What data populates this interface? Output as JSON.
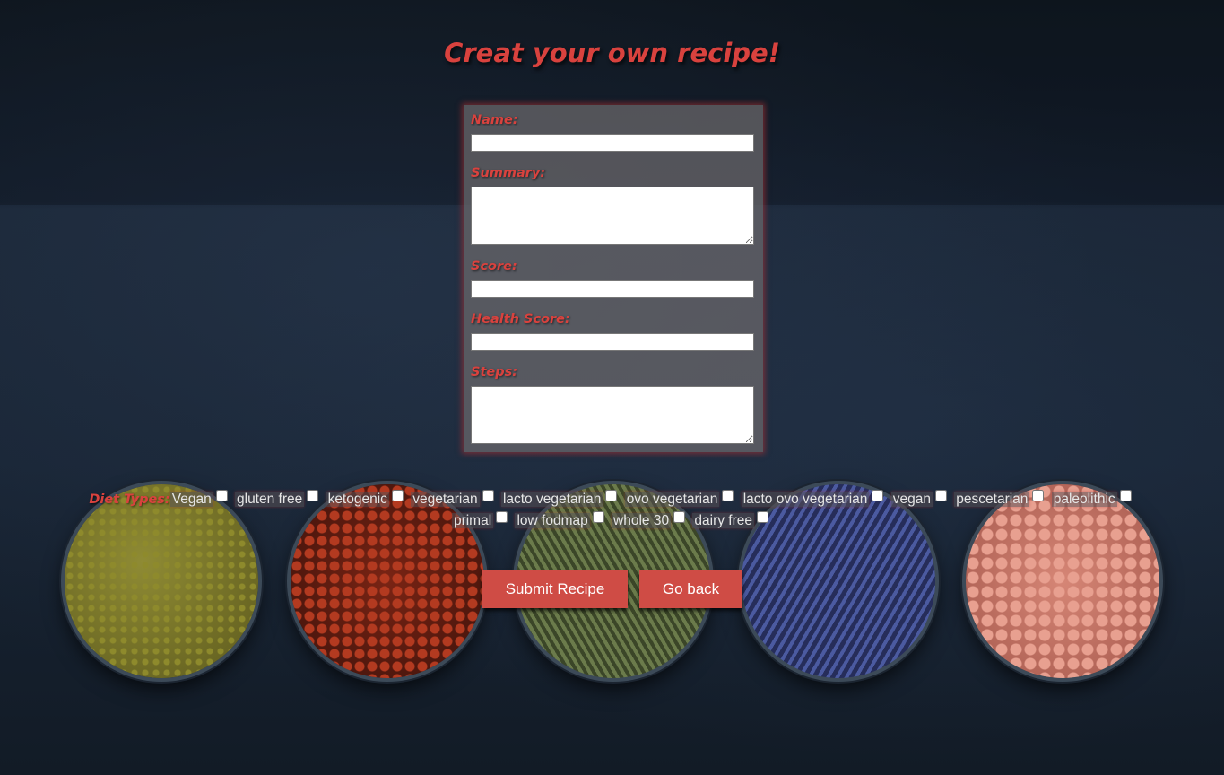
{
  "page": {
    "title": "Creat your own recipe!"
  },
  "form": {
    "name_label": "Name:",
    "summary_label": "Summary:",
    "score_label": "Score:",
    "health_score_label": "Health Score:",
    "steps_label": "Steps:",
    "name_value": "",
    "summary_value": "",
    "score_value": "",
    "health_score_value": "",
    "steps_value": ""
  },
  "diet": {
    "label": "Diet Types:",
    "options": [
      {
        "label": "Vegan",
        "checked": false
      },
      {
        "label": "gluten free",
        "checked": false
      },
      {
        "label": "ketogenic",
        "checked": false
      },
      {
        "label": "vegetarian",
        "checked": false
      },
      {
        "label": "lacto vegetarian",
        "checked": false
      },
      {
        "label": "ovo vegetarian",
        "checked": false
      },
      {
        "label": "lacto ovo vegetarian",
        "checked": false
      },
      {
        "label": "vegan",
        "checked": false
      },
      {
        "label": "pescetarian",
        "checked": false
      },
      {
        "label": "paleolithic",
        "checked": false
      },
      {
        "label": "primal",
        "checked": false
      },
      {
        "label": "low fodmap",
        "checked": false
      },
      {
        "label": "whole 30",
        "checked": false
      },
      {
        "label": "dairy free",
        "checked": false
      }
    ]
  },
  "buttons": {
    "submit_label": "Submit Recipe",
    "back_label": "Go back"
  },
  "colors": {
    "accent": "#d9423e",
    "button": "#cf4c45",
    "background": "#152030"
  }
}
